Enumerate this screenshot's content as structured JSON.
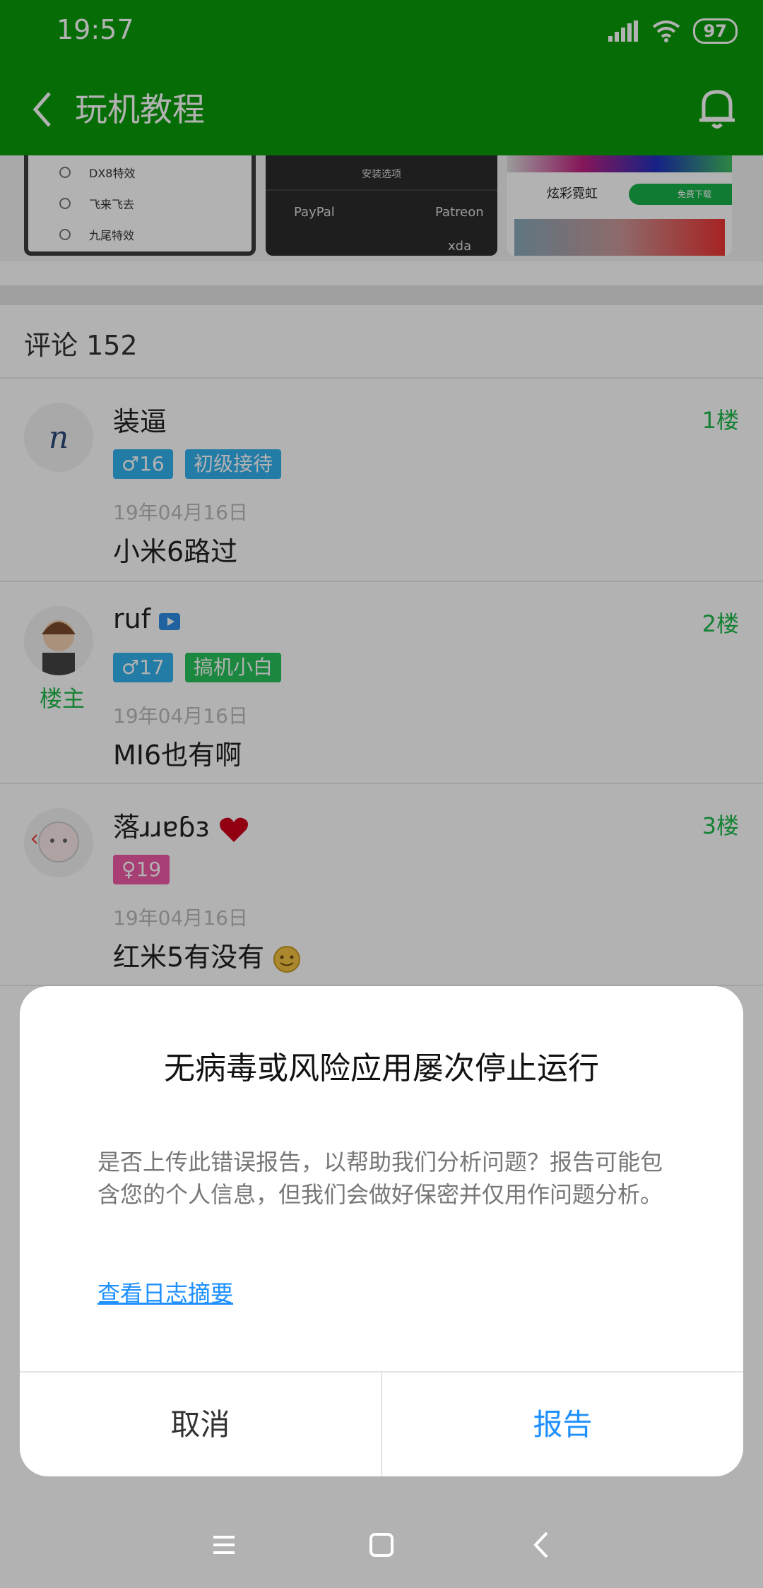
{
  "status": {
    "time": "19:57",
    "battery": "97"
  },
  "app_bar": {
    "title": "玩机教程"
  },
  "thumbnails": {
    "t1_options": [
      "DX8特效",
      "飞来飞去",
      "九尾特效"
    ],
    "t2_install": "安装选项",
    "t2_paypal": "PayPal",
    "t2_patreon": "Patreon",
    "t2_xda": "xda",
    "t3_app_name": "炫彩霓虹",
    "t3_download": "免费下载"
  },
  "comments_header": "评论 152",
  "comments": [
    {
      "username": "装逼",
      "gender_age": "♂16",
      "level": "初级接待",
      "date": "19年04月16日",
      "content": "小米6路过",
      "floor": "1楼"
    },
    {
      "username": "ruf",
      "gender_age": "♂17",
      "level": "搞机小白",
      "date": "19年04月16日",
      "content": "MI6也有啊",
      "floor": "2楼",
      "host_tag": "楼主"
    },
    {
      "username": "落ɹɹɐɓɜ",
      "gender_age": "♀19",
      "date": "19年04月16日",
      "content": "红米5有没有",
      "floor": "3楼"
    }
  ],
  "dialog": {
    "title": "无病毒或风险应用屡次停止运行",
    "message": "是否上传此错误报告，以帮助我们分析问题？报告可能包含您的个人信息，但我们会做好保密并仅用作问题分析。",
    "link": "查看日志摘要",
    "cancel": "取消",
    "report": "报告"
  },
  "colors": {
    "primary_green": "#0a9d0a",
    "accent_blue": "#1e90ff",
    "floor_green": "#1fb94a"
  }
}
